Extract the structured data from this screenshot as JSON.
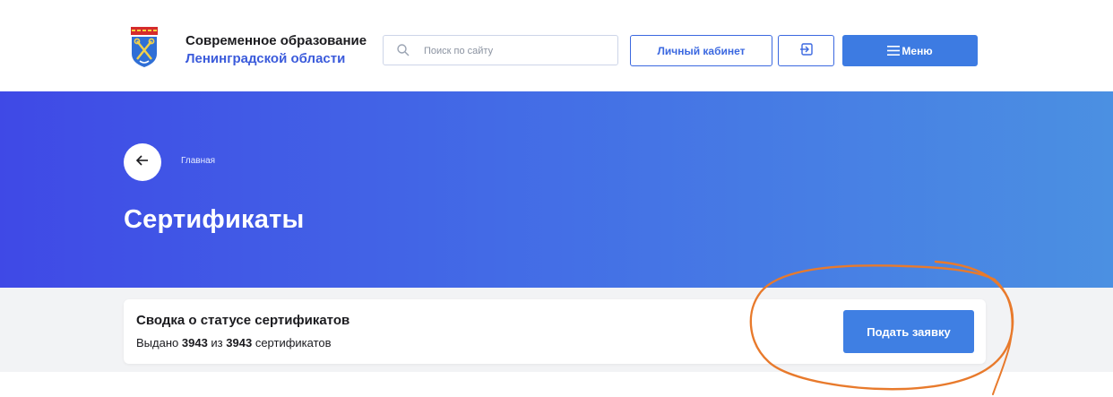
{
  "header": {
    "brand_line1": "Современное образование",
    "brand_line2": "Ленинградской области",
    "search_placeholder": "Поиск по сайту",
    "cabinet_label": "Личный кабинет",
    "menu_label": "Меню"
  },
  "hero": {
    "breadcrumb": "Главная",
    "title": "Сертификаты"
  },
  "summary": {
    "heading": "Сводка о статусе сертификатов",
    "issued_prefix": "Выдано",
    "issued_count": "3943",
    "middle": "из",
    "total_count": "3943",
    "suffix": "сертификатов",
    "apply_label": "Подать заявку"
  },
  "colors": {
    "brand_blue": "#3b5bdb",
    "button_blue": "#3f7fe3",
    "hero_start": "#3f49e6",
    "hero_end": "#4b90e2",
    "annotation": "#e87a2c"
  },
  "icons": {
    "logo": "coat-of-arms-icon",
    "search": "search-icon",
    "login": "login-icon",
    "menu": "hamburger-icon",
    "back": "arrow-left-icon"
  }
}
